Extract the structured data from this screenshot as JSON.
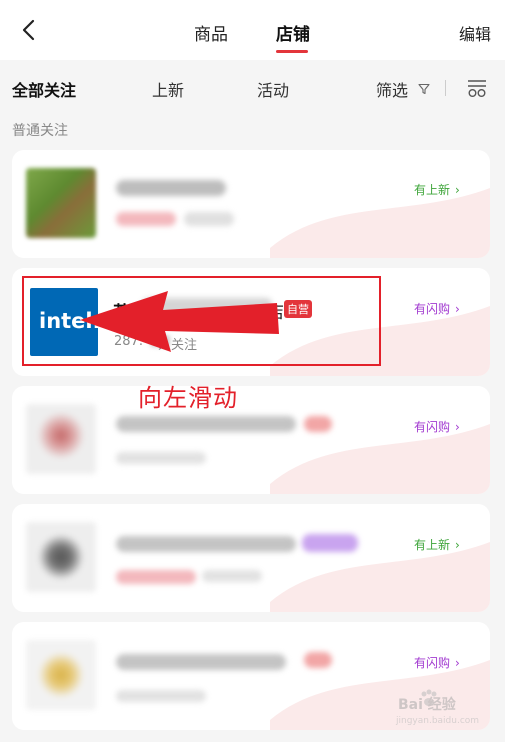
{
  "header": {
    "tabs": [
      {
        "label": "商品",
        "active": false
      },
      {
        "label": "店铺",
        "active": true
      }
    ],
    "edit_label": "编辑",
    "accent_color": "#e3353b"
  },
  "filter_bar": {
    "tabs": [
      {
        "label": "全部关注",
        "active": true
      },
      {
        "label": "上新",
        "active": false
      },
      {
        "label": "活动",
        "active": false
      }
    ],
    "filter_label": "筛选",
    "filter_icon": "funnel-icon",
    "layout_icon": "list-layout-icon"
  },
  "section": {
    "title": "普通关注"
  },
  "shops": [
    {
      "cta": "有上新",
      "cta_color": "#3ea53a"
    },
    {
      "logo_text": "intel.",
      "name": "英",
      "name_tail": "店",
      "badge": "自营",
      "followers": "287.",
      "followers_suffix": "人关注",
      "cta": "有闪购",
      "cta_color": "#a23ad0"
    },
    {
      "cta": "有闪购",
      "cta_color": "#a23ad0"
    },
    {
      "cta": "有上新",
      "cta_color": "#3ea53a"
    },
    {
      "cta": "有闪购",
      "cta_color": "#a23ad0"
    }
  ],
  "annotation": {
    "callout": "向左滑动",
    "color": "#e3202a"
  },
  "watermark": {
    "text": "Bai 经验",
    "url": "jingyan.baidu.com"
  }
}
